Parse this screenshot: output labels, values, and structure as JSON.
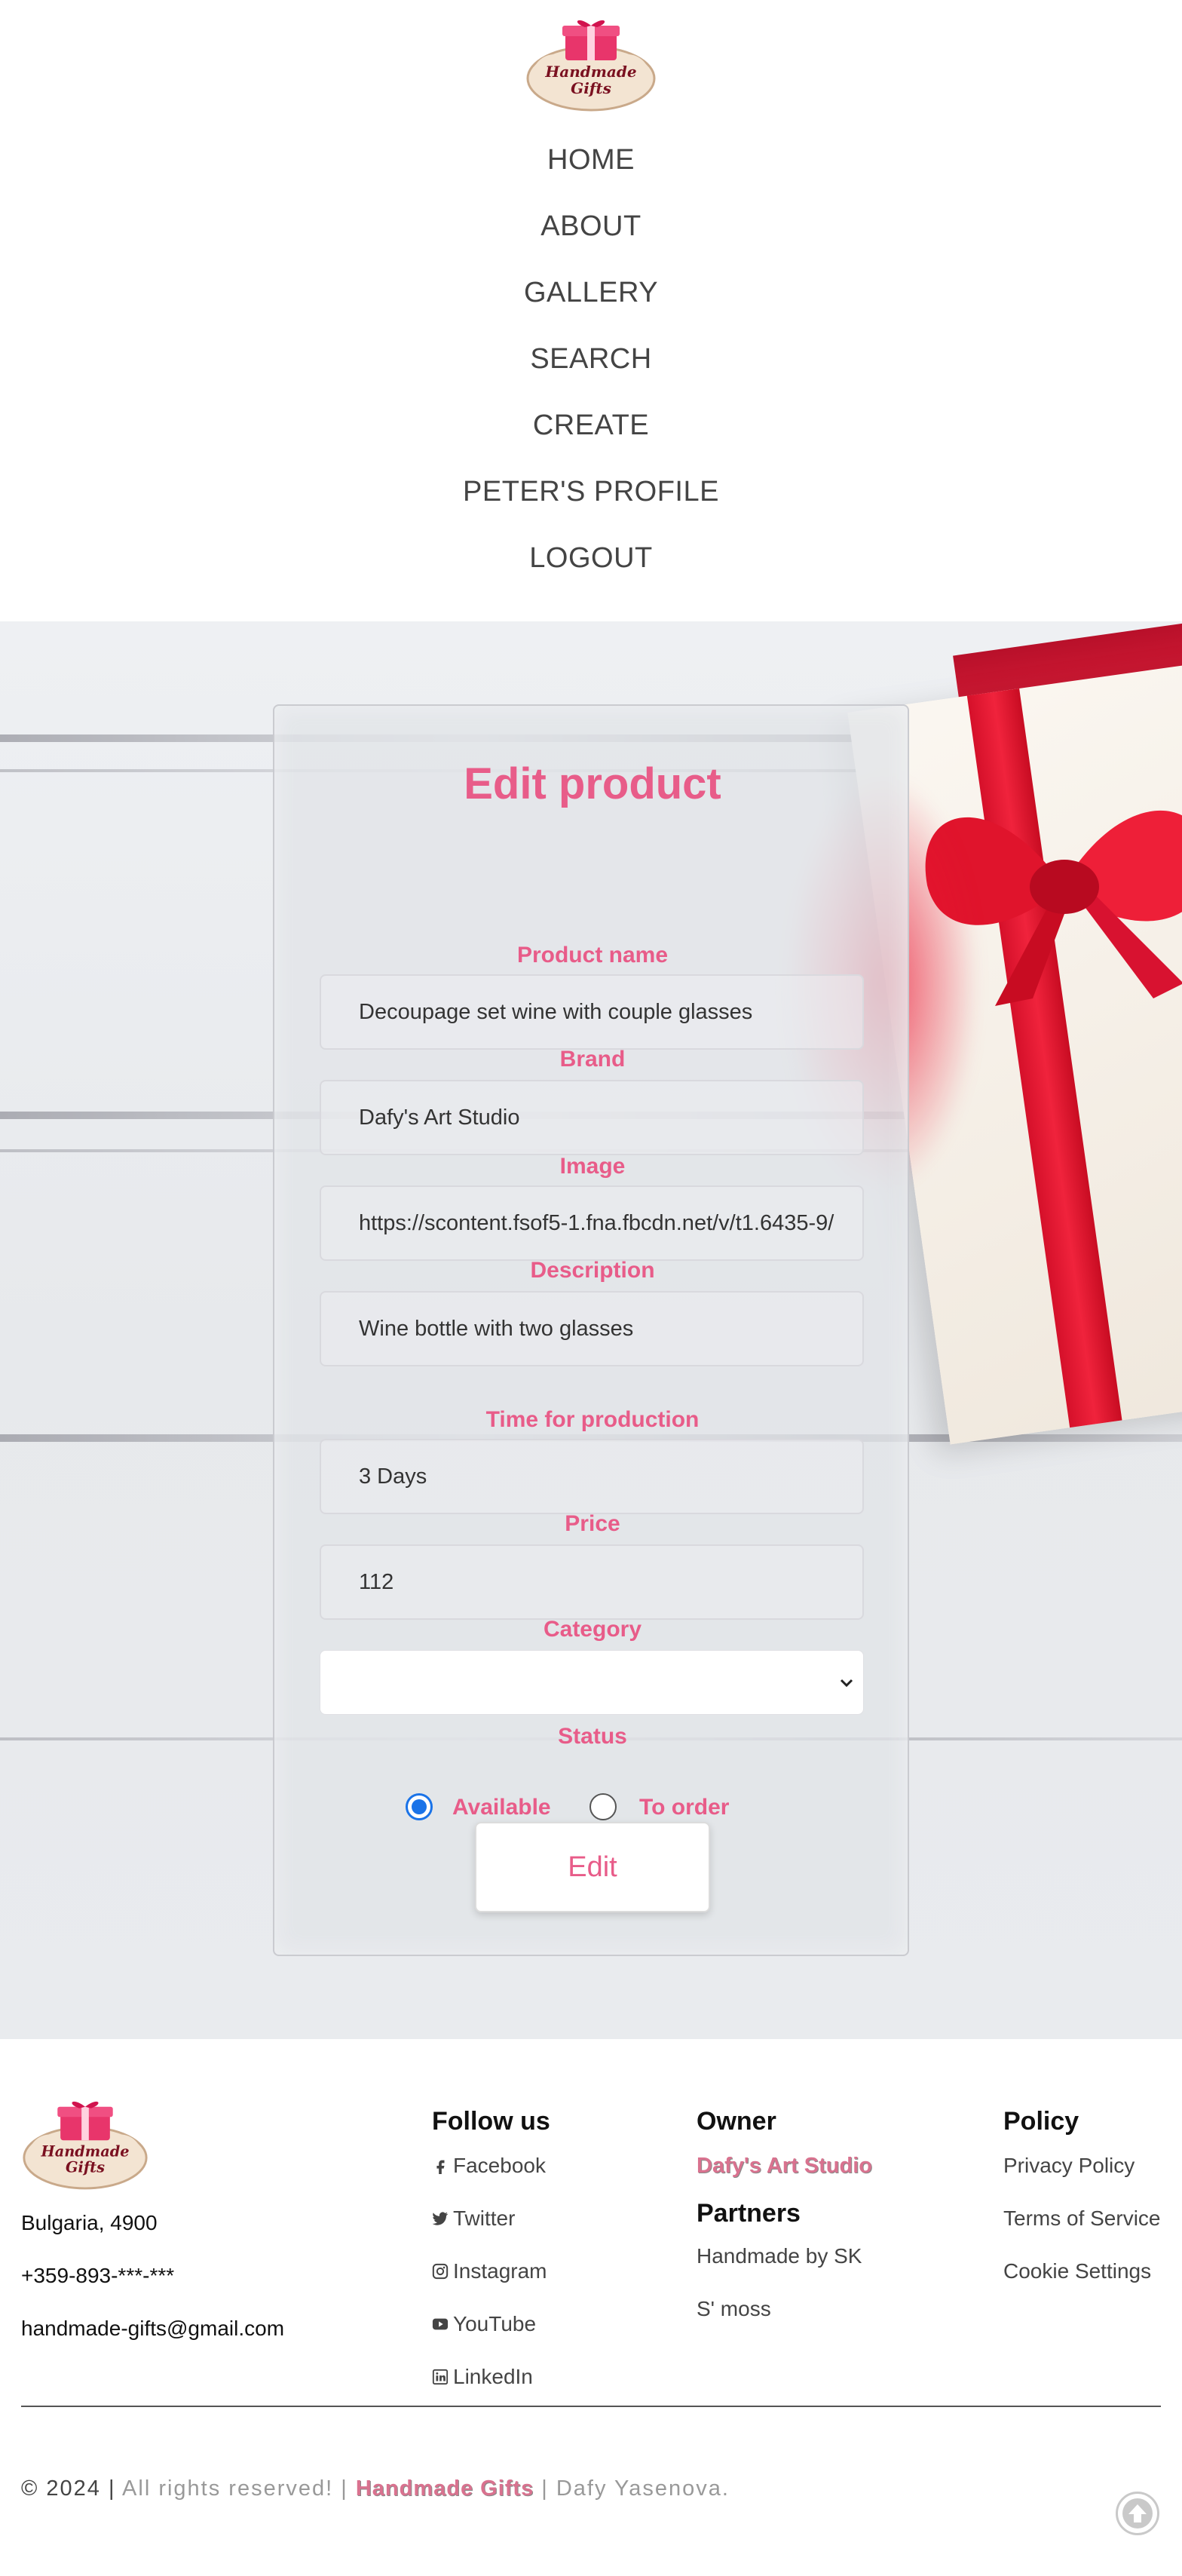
{
  "brand": {
    "logo_line1": "Handmade",
    "logo_line2": "Gifts",
    "accent_color": "#e85c89"
  },
  "nav": {
    "items": [
      {
        "label": "HOME"
      },
      {
        "label": "ABOUT"
      },
      {
        "label": "GALLERY"
      },
      {
        "label": "SEARCH"
      },
      {
        "label": "CREATE"
      },
      {
        "label": "PETER'S PROFILE"
      },
      {
        "label": "LOGOUT"
      }
    ]
  },
  "form": {
    "title": "Edit product",
    "product_name": {
      "label": "Product name",
      "value": "Decoupage set wine with couple glasses"
    },
    "brand": {
      "label": "Brand",
      "value": "Dafy's Art Studio"
    },
    "image": {
      "label": "Image",
      "value": "https://scontent.fsof5-1.fna.fbcdn.net/v/t1.6435-9/"
    },
    "description": {
      "label": "Description",
      "value": "Wine bottle with two glasses"
    },
    "production_time": {
      "label": "Time for production",
      "value": "3 Days"
    },
    "price": {
      "label": "Price",
      "value": "112"
    },
    "category": {
      "label": "Category",
      "value": ""
    },
    "status": {
      "label": "Status",
      "options": [
        {
          "label": "Available",
          "checked": true
        },
        {
          "label": "To order",
          "checked": false
        }
      ]
    },
    "submit_label": "Edit"
  },
  "footer": {
    "contact": {
      "address": "Bulgaria, 4900",
      "phone": "+359-893-***-***",
      "email": "handmade-gifts@gmail.com"
    },
    "follow": {
      "heading": "Follow us",
      "items": [
        {
          "label": "Facebook",
          "icon": "facebook-icon"
        },
        {
          "label": "Twitter",
          "icon": "twitter-icon"
        },
        {
          "label": "Instagram",
          "icon": "instagram-icon"
        },
        {
          "label": "YouTube",
          "icon": "youtube-icon"
        },
        {
          "label": "LinkedIn",
          "icon": "linkedin-icon"
        }
      ]
    },
    "owner": {
      "heading": "Owner",
      "name": "Dafy's Art Studio"
    },
    "partners": {
      "heading": "Partners",
      "items": [
        "Handmade by SK",
        "S' moss"
      ]
    },
    "policy": {
      "heading": "Policy",
      "items": [
        "Privacy Policy",
        "Terms of Service",
        "Cookie Settings"
      ]
    },
    "copyright": {
      "prefix": "© 2024",
      "sep1": "|",
      "rights": "All rights reserved! |",
      "brand": "Handmade Gifts",
      "suffix": "| Dafy Yasenova."
    }
  }
}
